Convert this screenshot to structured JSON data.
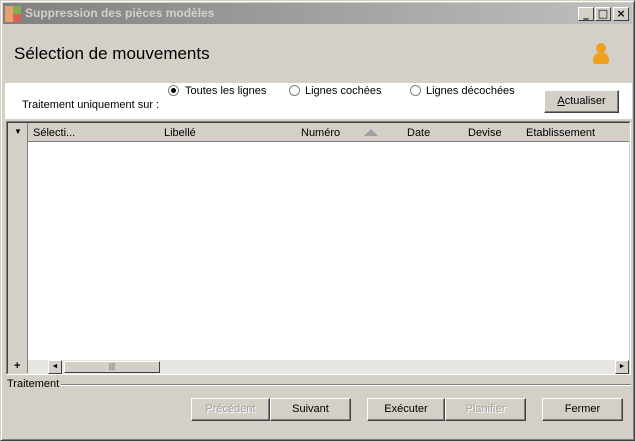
{
  "window": {
    "title": "Suppression des pièces modèles",
    "buttons": {
      "minimize": "_",
      "maximize": "□",
      "close": "×"
    }
  },
  "header": {
    "title": "Sélection de mouvements"
  },
  "options": {
    "label": "Traitement uniquement sur :",
    "radios": [
      {
        "label": "Toutes les lignes",
        "checked": true
      },
      {
        "label": "Lignes cochées",
        "checked": false
      },
      {
        "label": "Lignes décochées",
        "checked": false
      }
    ],
    "refresh_label_u": "A",
    "refresh_label_rest": "ctualiser"
  },
  "grid": {
    "columns": [
      "Sélecti...",
      "Libellé",
      "Numéro",
      "Date",
      "Devise",
      "Etablissement"
    ],
    "row_header_menu": "▼",
    "add_row": "+",
    "thumb_grip": "|||",
    "scroll_left": "◄",
    "scroll_right": "►"
  },
  "section": {
    "label": "Traitement"
  },
  "footer": {
    "previous": "Précédent",
    "next": "Suivant",
    "execute": "Exécuter",
    "plan": "Planifier",
    "close": "Fermer"
  },
  "colors": {
    "title_gradient_start": "#808080",
    "title_gradient_end": "#c0c0c0",
    "face": "#d4d0c8",
    "user_icon": "#f0a020"
  }
}
